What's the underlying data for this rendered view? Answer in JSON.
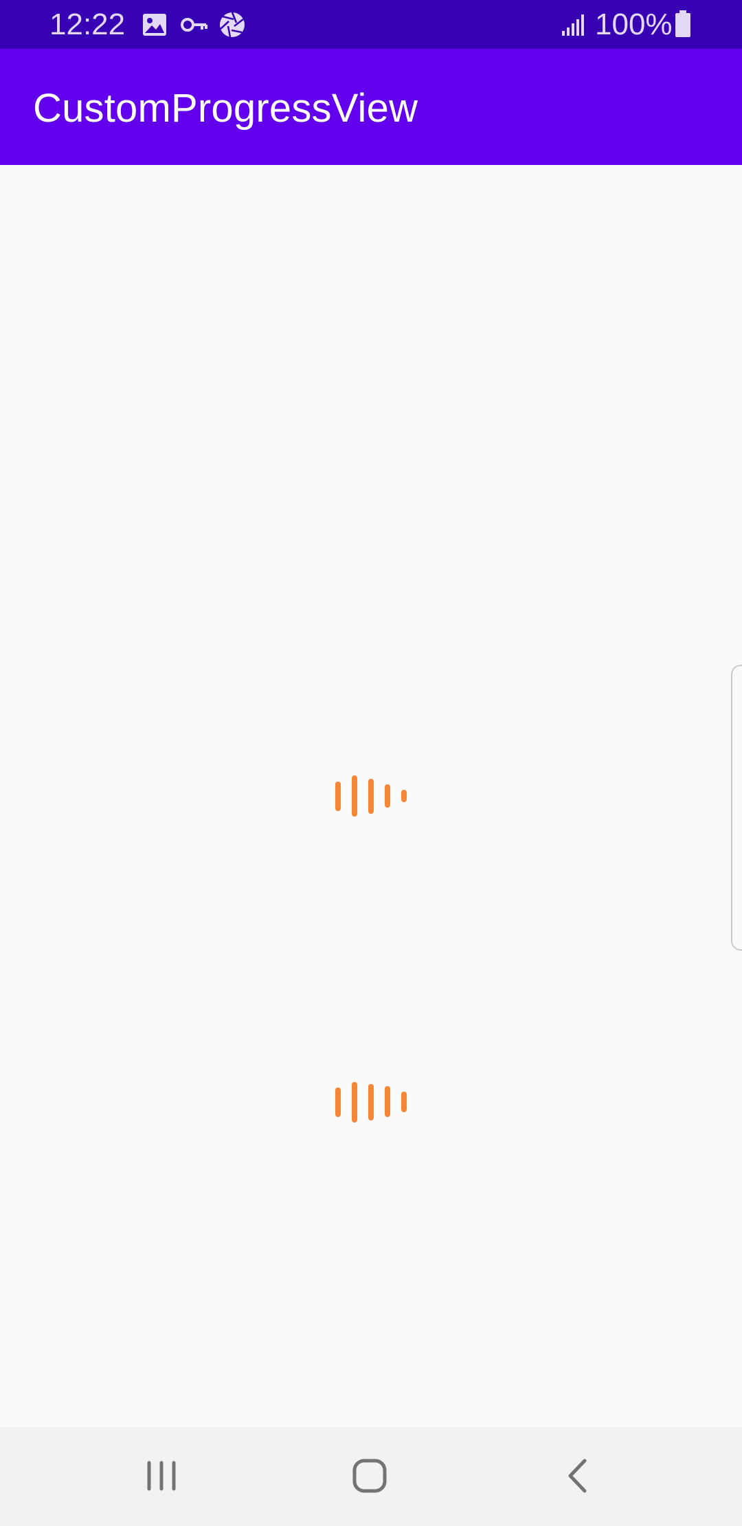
{
  "status_bar": {
    "time": "12:22",
    "battery": "100%",
    "icons": [
      "image-icon",
      "key-icon",
      "aperture-icon",
      "signal-icon",
      "battery-icon"
    ]
  },
  "app_bar": {
    "title": "CustomProgressView"
  },
  "colors": {
    "status_bar": "#3700b3",
    "app_bar": "#6200ee",
    "loader_bars": "#f58634",
    "background": "#fafafa",
    "nav_bar": "#f2f2f2"
  },
  "progress_views": [
    {
      "name": "progress-view-1"
    },
    {
      "name": "progress-view-2"
    }
  ],
  "nav_bar": {
    "buttons": [
      "recent-apps-icon",
      "home-icon",
      "back-icon"
    ]
  }
}
